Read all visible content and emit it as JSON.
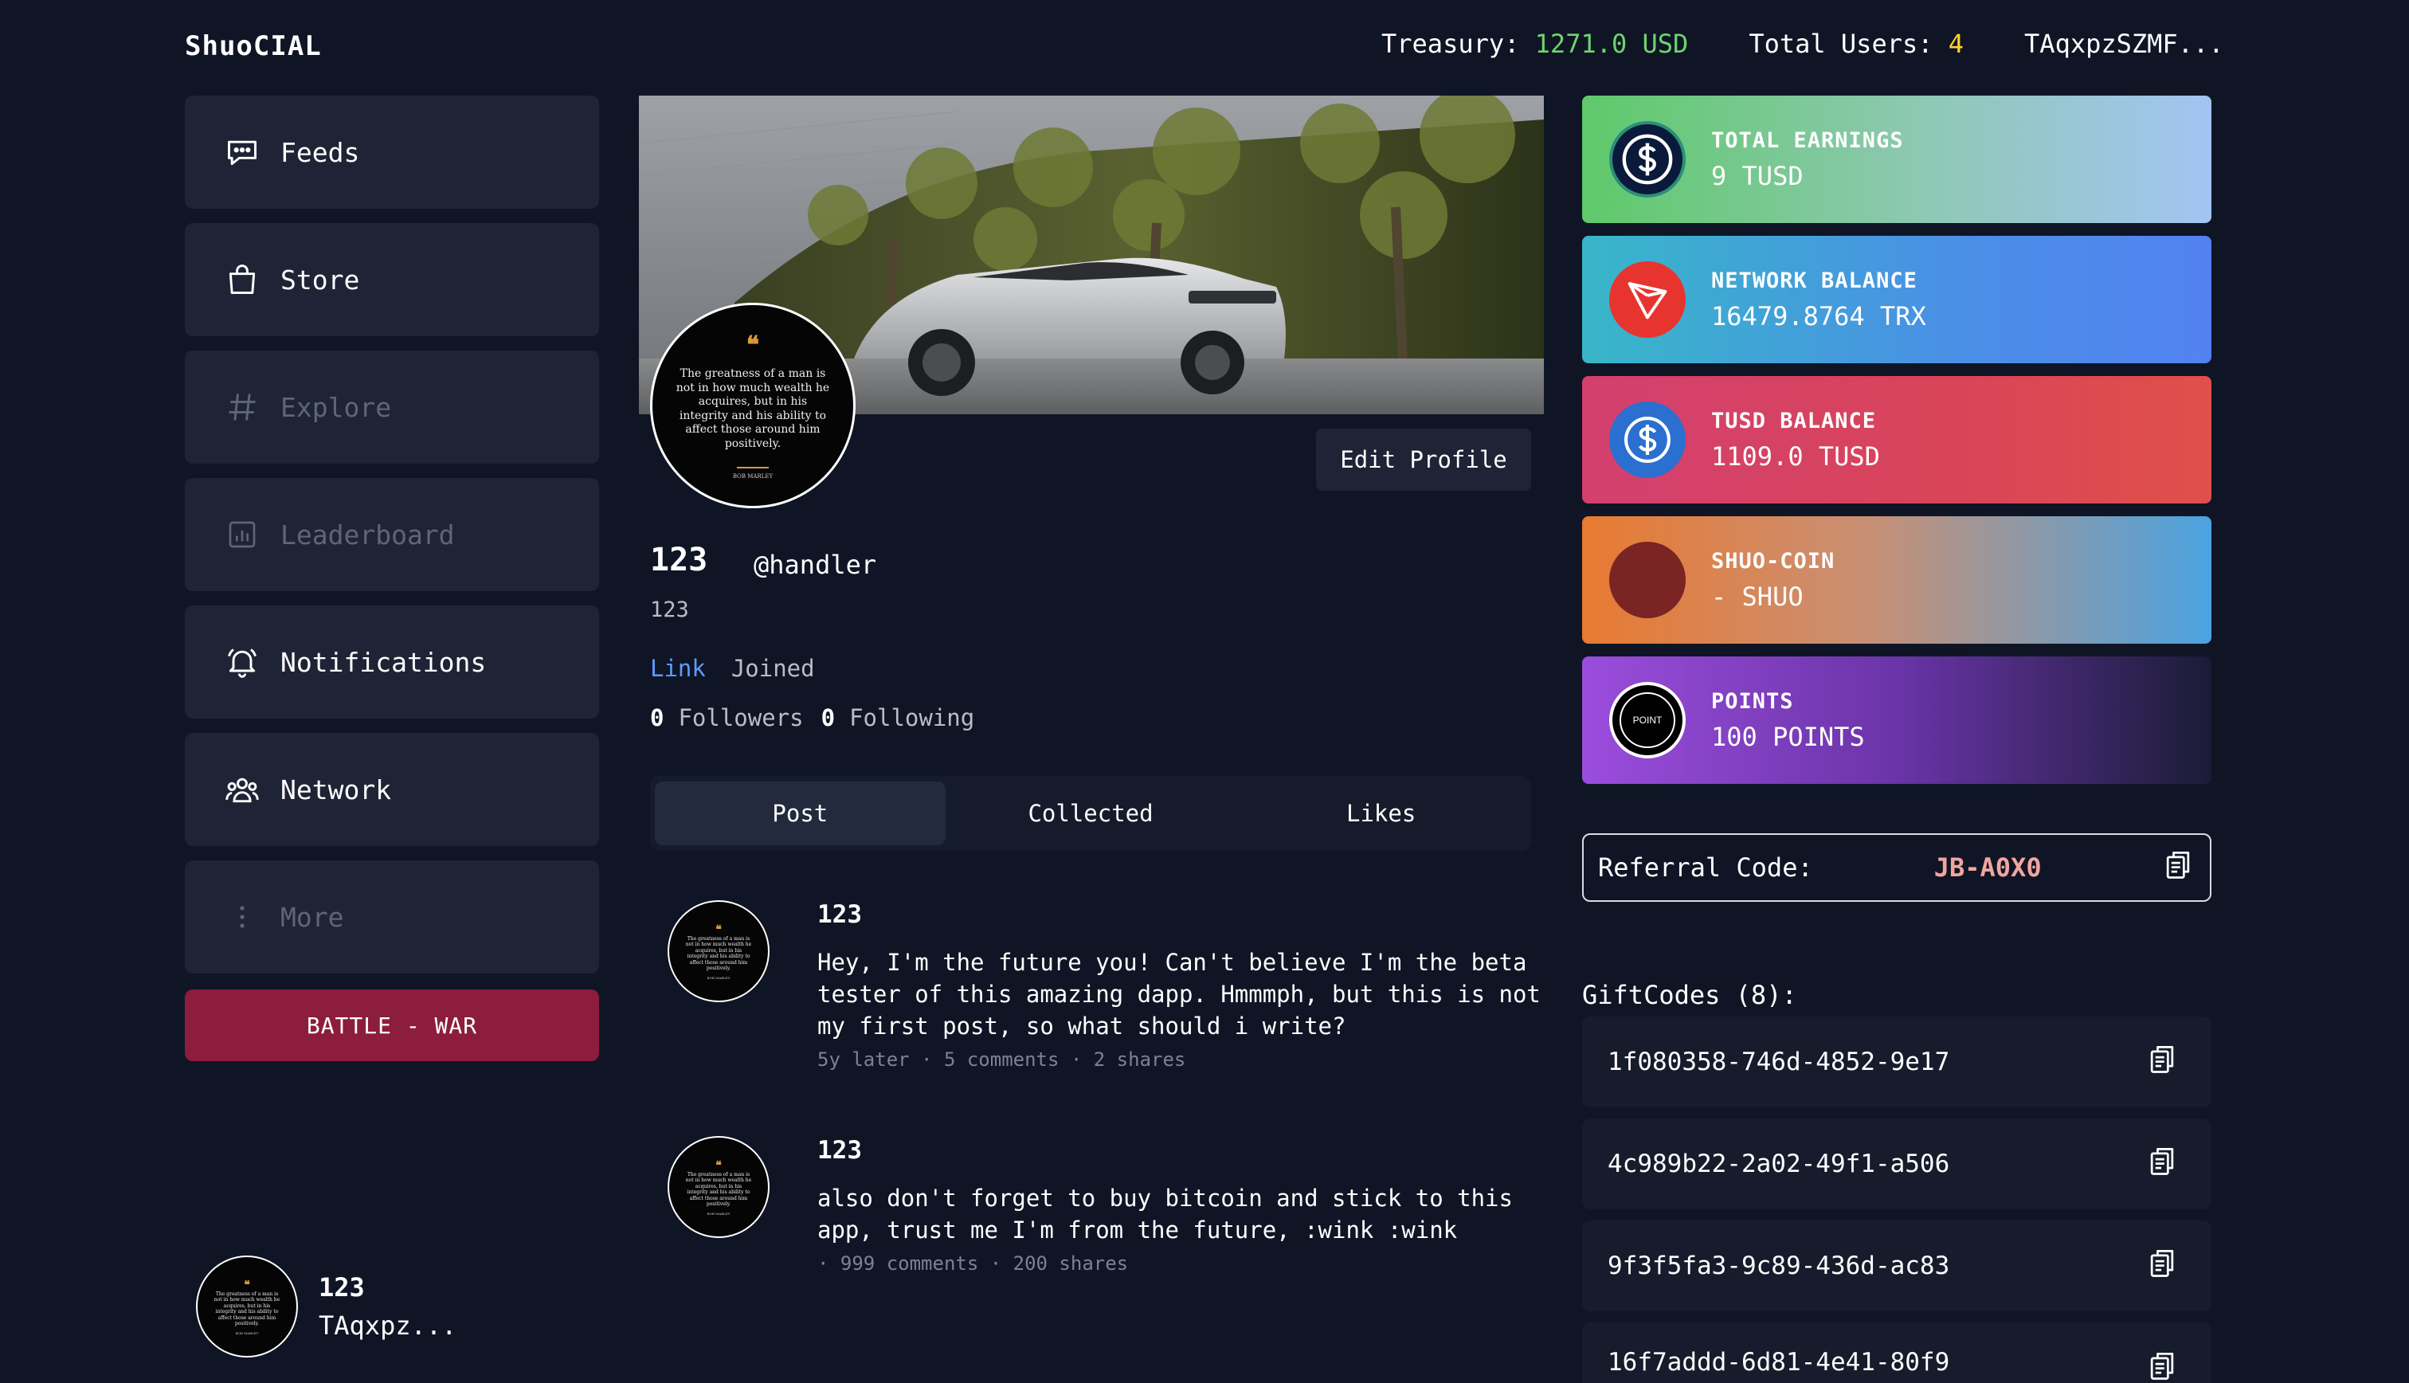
{
  "header": {
    "brand": "ShuoCIAL",
    "treasury_label": "Treasury:",
    "treasury_value": "1271.0 USD",
    "users_label": "Total Users:",
    "users_value": "4",
    "account": "TAqxpzSZMF..."
  },
  "sidebar": {
    "items": [
      {
        "label": "Feeds",
        "icon": "chat-bubble-icon"
      },
      {
        "label": "Store",
        "icon": "shopping-bag-icon"
      },
      {
        "label": "Explore",
        "icon": "hash-icon"
      },
      {
        "label": "Leaderboard",
        "icon": "bar-chart-icon"
      },
      {
        "label": "Notifications",
        "icon": "bell-icon"
      },
      {
        "label": "Network",
        "icon": "users-icon"
      },
      {
        "label": "More",
        "icon": "vertical-dots-icon"
      }
    ],
    "battle_label": "BATTLE - WAR",
    "user_name": "123",
    "user_address": "TAqxpz..."
  },
  "avatar_quote": {
    "mark": "❝",
    "text": "The greatness of a man is not in how much wealth he acquires, but in his integrity and his ability to affect those around him positively.",
    "author": "BOB MARLEY"
  },
  "profile": {
    "edit_label": "Edit Profile",
    "name": "123",
    "handle": "@handler",
    "bio": "123",
    "link_label": "Link",
    "joined_label": "Joined",
    "followers_count": "0",
    "followers_label": "Followers",
    "following_count": "0",
    "following_label": "Following"
  },
  "tabs": [
    {
      "label": "Post",
      "active": true
    },
    {
      "label": "Collected",
      "active": false
    },
    {
      "label": "Likes",
      "active": false
    }
  ],
  "posts": [
    {
      "author": "123",
      "text": "Hey, I'm the future you! Can't believe I'm the beta tester of this amazing dapp. Hmmmph, but this is not my first post, so what should i write?",
      "meta": "5y later · 5 comments · 2 shares"
    },
    {
      "author": "123",
      "text": "also don't forget to buy bitcoin and stick to this app, trust me I'm from the future, :wink :wink",
      "meta": " · 999 comments · 200 shares"
    }
  ],
  "stats": [
    {
      "title": "TOTAL EARNINGS",
      "value": "9 TUSD",
      "icon": "dollar-coin-icon"
    },
    {
      "title": "NETWORK BALANCE",
      "value": "16479.8764 TRX",
      "icon": "tron-icon"
    },
    {
      "title": "TUSD BALANCE",
      "value": "1109.0 TUSD",
      "icon": "usdc-coin-icon"
    },
    {
      "title": "SHUO-COIN",
      "value": "- SHUO",
      "icon": "shuo-coin-icon"
    },
    {
      "title": "POINTS",
      "value": "100 POINTS",
      "icon": "points-icon",
      "icon_text": "POINT"
    }
  ],
  "referral": {
    "label": "Referral Code:",
    "code": "JB-A0X0"
  },
  "giftcodes": {
    "title": "GiftCodes (8):",
    "codes": [
      "1f080358-746d-4852-9e17",
      "4c989b22-2a02-49f1-a506",
      "9f3f5fa3-9c89-436d-ac83",
      "16f7addd-6d81-4e41-80f9"
    ]
  },
  "colors": {
    "background": "#0f1525",
    "panel": "#1e2435",
    "battle": "#8c1d3c",
    "treasury": "#6fd36f",
    "users": "#ffd22e",
    "link": "#5c9cff",
    "referral_code": "#f2a5a0"
  }
}
